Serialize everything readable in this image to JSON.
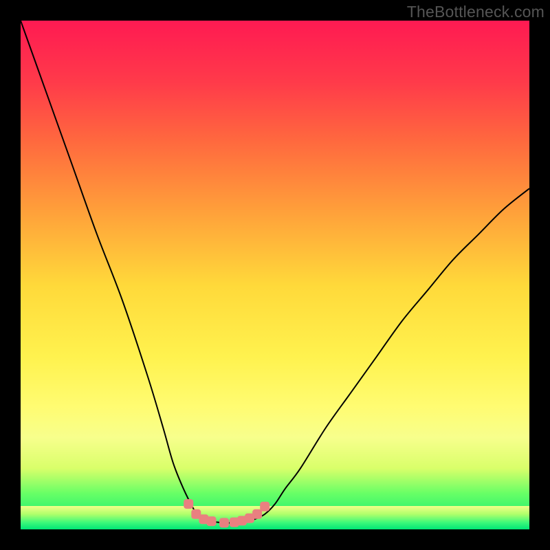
{
  "attribution": "TheBottleneck.com",
  "colors": {
    "curve": "#000000",
    "dots": "#e98080",
    "gradient_top": "#ff1a52",
    "gradient_bottom": "#00e676"
  },
  "chart_data": {
    "type": "line",
    "title": "",
    "xlabel": "",
    "ylabel": "",
    "xlim": [
      0,
      100
    ],
    "ylim": [
      0,
      100
    ],
    "grid": false,
    "legend": false,
    "series": [
      {
        "name": "bottleneck-curve",
        "x": [
          0,
          5,
          10,
          15,
          20,
          25,
          28,
          30,
          32,
          34,
          35,
          36,
          38,
          40,
          42,
          44,
          46,
          48,
          50,
          52,
          55,
          60,
          65,
          70,
          75,
          80,
          85,
          90,
          95,
          100
        ],
        "y": [
          100,
          86,
          72,
          58,
          45,
          30,
          20,
          13,
          8,
          4,
          2.5,
          2,
          1.5,
          1.3,
          1.3,
          1.5,
          2,
          3,
          5,
          8,
          12,
          20,
          27,
          34,
          41,
          47,
          53,
          58,
          63,
          67
        ]
      }
    ],
    "salient_points": {
      "name": "flat-minimum-markers",
      "x": [
        33,
        34.5,
        36,
        37.5,
        40,
        42,
        43.5,
        45,
        46.5,
        48
      ],
      "y": [
        5,
        3,
        2,
        1.6,
        1.3,
        1.4,
        1.7,
        2.2,
        3,
        4.5
      ]
    }
  }
}
